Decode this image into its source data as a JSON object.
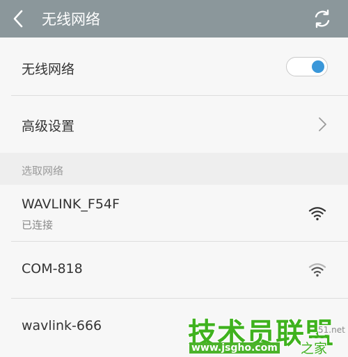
{
  "header": {
    "title": "无线网络"
  },
  "settings": {
    "wifi_label": "无线网络",
    "wifi_enabled": true,
    "advanced_label": "高级设置"
  },
  "section": {
    "select_network_label": "选取网络"
  },
  "networks": [
    {
      "name": "WAVLINK_F54F",
      "status": "已连接"
    },
    {
      "name": "COM-818",
      "status": ""
    },
    {
      "name": "wavlink-666",
      "status": ""
    }
  ],
  "watermark": {
    "main": "技术员联盟",
    "url": "www.jsgho.com",
    "suffix": "之家",
    "side": "51.net"
  },
  "colors": {
    "header_bg": "#8b979b",
    "accent": "#3a97d9",
    "watermark_green": "#3fb21e"
  }
}
